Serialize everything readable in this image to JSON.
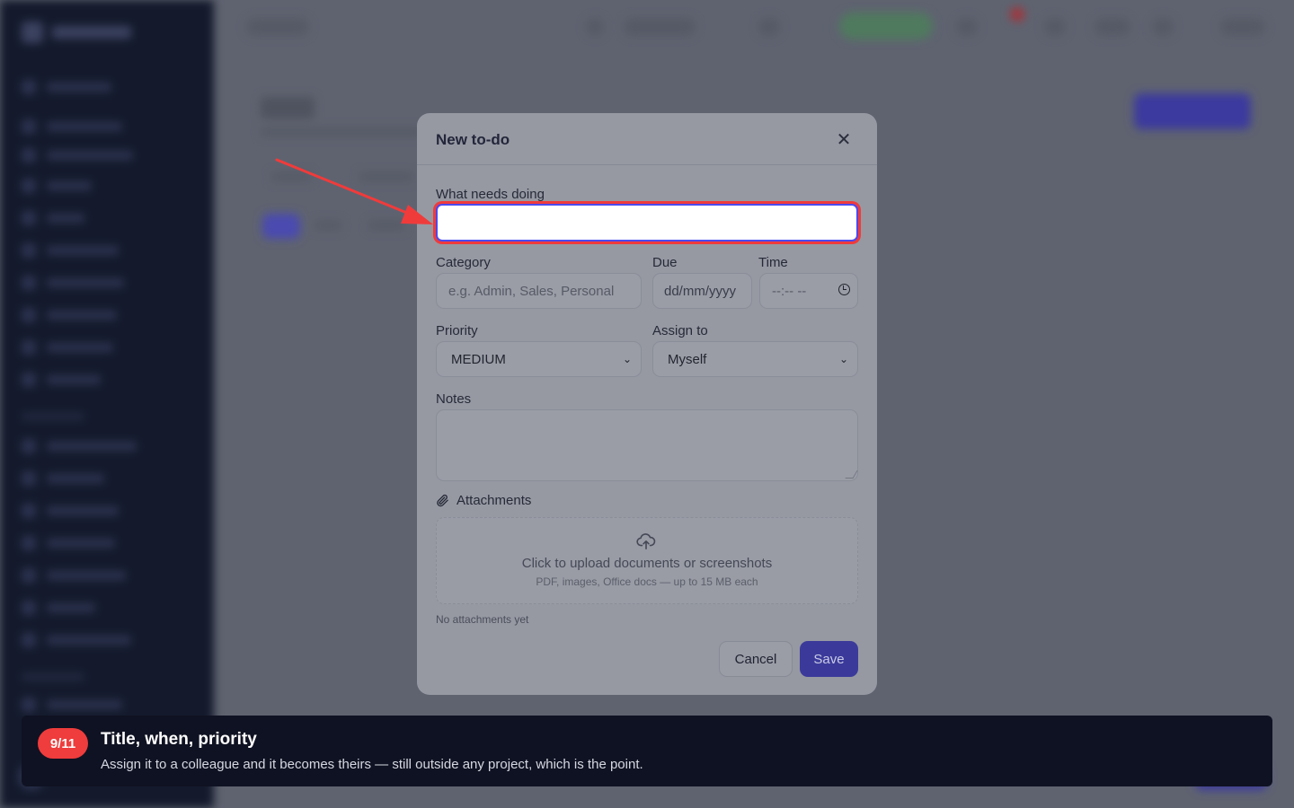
{
  "modal": {
    "title": "New to-do",
    "close_icon": "close-icon",
    "fields": {
      "title": {
        "label": "What needs doing",
        "value": ""
      },
      "category": {
        "label": "Category",
        "placeholder": "e.g. Admin, Sales, Personal"
      },
      "due": {
        "label": "Due",
        "placeholder": "dd/mm/yyyy"
      },
      "time": {
        "label": "Time",
        "placeholder": "--:-- --"
      },
      "priority": {
        "label": "Priority",
        "selected": "MEDIUM"
      },
      "assign": {
        "label": "Assign to",
        "selected": "Myself"
      },
      "notes": {
        "label": "Notes",
        "value": ""
      }
    },
    "attachments": {
      "label": "Attachments",
      "upload_text": "Click to upload documents or screenshots",
      "upload_hint": "PDF, images, Office docs — up to 15 MB each",
      "empty_text": "No attachments yet"
    },
    "buttons": {
      "cancel": "Cancel",
      "save": "Save"
    }
  },
  "tour": {
    "step": "9/11",
    "title": "Title, when, priority",
    "description": "Assign it to a colleague and it becomes theirs — still outside any project, which is the point."
  },
  "colors": {
    "highlight": "#f03b3b",
    "accent": "#3b3a9b",
    "tour_bg": "#0f1222"
  }
}
